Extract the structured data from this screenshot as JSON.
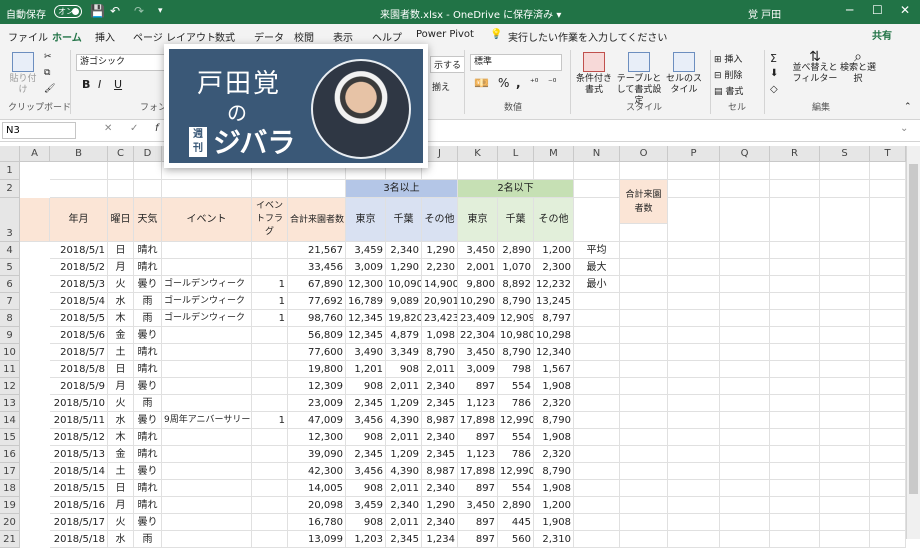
{
  "titlebar": {
    "autosave": "自動保存",
    "toggle": "オン",
    "doc_title": "来園者数.xlsx - OneDrive に保存済み ▾",
    "user": "覚 戸田",
    "min": "─",
    "max": "☐",
    "close": "✕"
  },
  "tabs": [
    "ファイル",
    "ホーム",
    "挿入",
    "ページ レイアウト",
    "数式",
    "データ",
    "校閲",
    "表示",
    "ヘルプ",
    "Power Pivot",
    "実行したい作業を入力してください"
  ],
  "share": "共有",
  "ribbon": {
    "paste": "貼り付け",
    "clipboard": "クリップボード",
    "font_name": "游ゴシック",
    "font_group": "フォン",
    "bold": "B",
    "italic": "I",
    "underline": "U",
    "wrap": "示する",
    "merge": "揃え",
    "number_format": "標準",
    "percent": "%",
    "comma": ",",
    "number_group": "数値",
    "cond_format": "条件付き書式",
    "table_format": "テーブルとして書式設定",
    "cell_style": "セルのスタイル",
    "style_group": "スタイル",
    "insert": "挿入",
    "delete": "削除",
    "format": "書式",
    "cell_group": "セル",
    "sort": "並べ替えとフィルター",
    "find": "検索と選択",
    "edit_group": "編集"
  },
  "formula": {
    "name_box": "N3",
    "cancel": "✕",
    "enter": "✓",
    "fx": "f"
  },
  "overlay": {
    "line1": "戸田覚",
    "line2": "の",
    "badge": "週刊",
    "line3": "ジバラ"
  },
  "columns": [
    "A",
    "B",
    "C",
    "D",
    "E",
    "F",
    "G",
    "H",
    "I",
    "J",
    "K",
    "L",
    "M",
    "N",
    "O",
    "P",
    "Q",
    "R",
    "S",
    "T"
  ],
  "row_numbers": [
    "1",
    "2",
    "3",
    "4",
    "5",
    "6",
    "7",
    "8",
    "9",
    "10",
    "11",
    "12",
    "13",
    "14",
    "15",
    "16",
    "17",
    "18",
    "19",
    "20",
    "21"
  ],
  "header": {
    "group3": "3名以上",
    "group2": "2名以下",
    "date": "年月",
    "weekday": "曜日",
    "weather": "天気",
    "event": "イベント",
    "flag": "イベントフラグ",
    "total": "合計来園者数",
    "tokyo": "東京",
    "chiba": "千葉",
    "other": "その他",
    "tokyo2": "東京",
    "chiba2": "千葉",
    "other2": "その他",
    "o_header": "合計来園者数"
  },
  "stats": [
    "平均",
    "最大",
    "最小"
  ],
  "rows": [
    [
      "2018/5/1",
      "日",
      "晴れ",
      "",
      "",
      "21,567",
      "3,459",
      "2,340",
      "1,290",
      "3,450",
      "2,890",
      "1,200"
    ],
    [
      "2018/5/2",
      "月",
      "晴れ",
      "",
      "",
      "33,456",
      "3,009",
      "1,290",
      "2,230",
      "2,001",
      "1,070",
      "2,300"
    ],
    [
      "2018/5/3",
      "火",
      "曇り",
      "ゴールデンウィーク",
      "1",
      "67,890",
      "12,300",
      "10,090",
      "14,900",
      "9,800",
      "8,892",
      "12,232"
    ],
    [
      "2018/5/4",
      "水",
      "雨",
      "ゴールデンウィーク",
      "1",
      "77,692",
      "16,789",
      "9,089",
      "20,901",
      "10,290",
      "8,790",
      "13,245"
    ],
    [
      "2018/5/5",
      "木",
      "雨",
      "ゴールデンウィーク",
      "1",
      "98,760",
      "12,345",
      "19,820",
      "23,423",
      "23,409",
      "12,909",
      "8,797"
    ],
    [
      "2018/5/6",
      "金",
      "曇り",
      "",
      "",
      "56,809",
      "12,345",
      "4,879",
      "1,098",
      "22,304",
      "10,980",
      "10,298"
    ],
    [
      "2018/5/7",
      "土",
      "晴れ",
      "",
      "",
      "77,600",
      "3,490",
      "3,349",
      "8,790",
      "3,450",
      "8,790",
      "12,340"
    ],
    [
      "2018/5/8",
      "日",
      "晴れ",
      "",
      "",
      "19,800",
      "1,201",
      "908",
      "2,011",
      "3,009",
      "798",
      "1,567"
    ],
    [
      "2018/5/9",
      "月",
      "曇り",
      "",
      "",
      "12,309",
      "908",
      "2,011",
      "2,340",
      "897",
      "554",
      "1,908"
    ],
    [
      "2018/5/10",
      "火",
      "雨",
      "",
      "",
      "23,009",
      "2,345",
      "1,209",
      "2,345",
      "1,123",
      "786",
      "2,320"
    ],
    [
      "2018/5/11",
      "水",
      "曇り",
      "9周年アニバーサリー",
      "1",
      "47,009",
      "3,456",
      "4,390",
      "8,987",
      "17,898",
      "12,990",
      "8,790"
    ],
    [
      "2018/5/12",
      "木",
      "晴れ",
      "",
      "",
      "12,300",
      "908",
      "2,011",
      "2,340",
      "897",
      "554",
      "1,908"
    ],
    [
      "2018/5/13",
      "金",
      "晴れ",
      "",
      "",
      "39,090",
      "2,345",
      "1,209",
      "2,345",
      "1,123",
      "786",
      "2,320"
    ],
    [
      "2018/5/14",
      "土",
      "曇り",
      "",
      "",
      "42,300",
      "3,456",
      "4,390",
      "8,987",
      "17,898",
      "12,990",
      "8,790"
    ],
    [
      "2018/5/15",
      "日",
      "晴れ",
      "",
      "",
      "14,005",
      "908",
      "2,011",
      "2,340",
      "897",
      "554",
      "1,908"
    ],
    [
      "2018/5/16",
      "月",
      "晴れ",
      "",
      "",
      "20,098",
      "3,459",
      "2,340",
      "1,290",
      "3,450",
      "2,890",
      "1,200"
    ],
    [
      "2018/5/17",
      "火",
      "曇り",
      "",
      "",
      "16,780",
      "908",
      "2,011",
      "2,340",
      "897",
      "445",
      "1,908"
    ],
    [
      "2018/5/18",
      "水",
      "雨",
      "",
      "",
      "13,099",
      "1,203",
      "2,345",
      "1,234",
      "897",
      "560",
      "2,310"
    ]
  ]
}
